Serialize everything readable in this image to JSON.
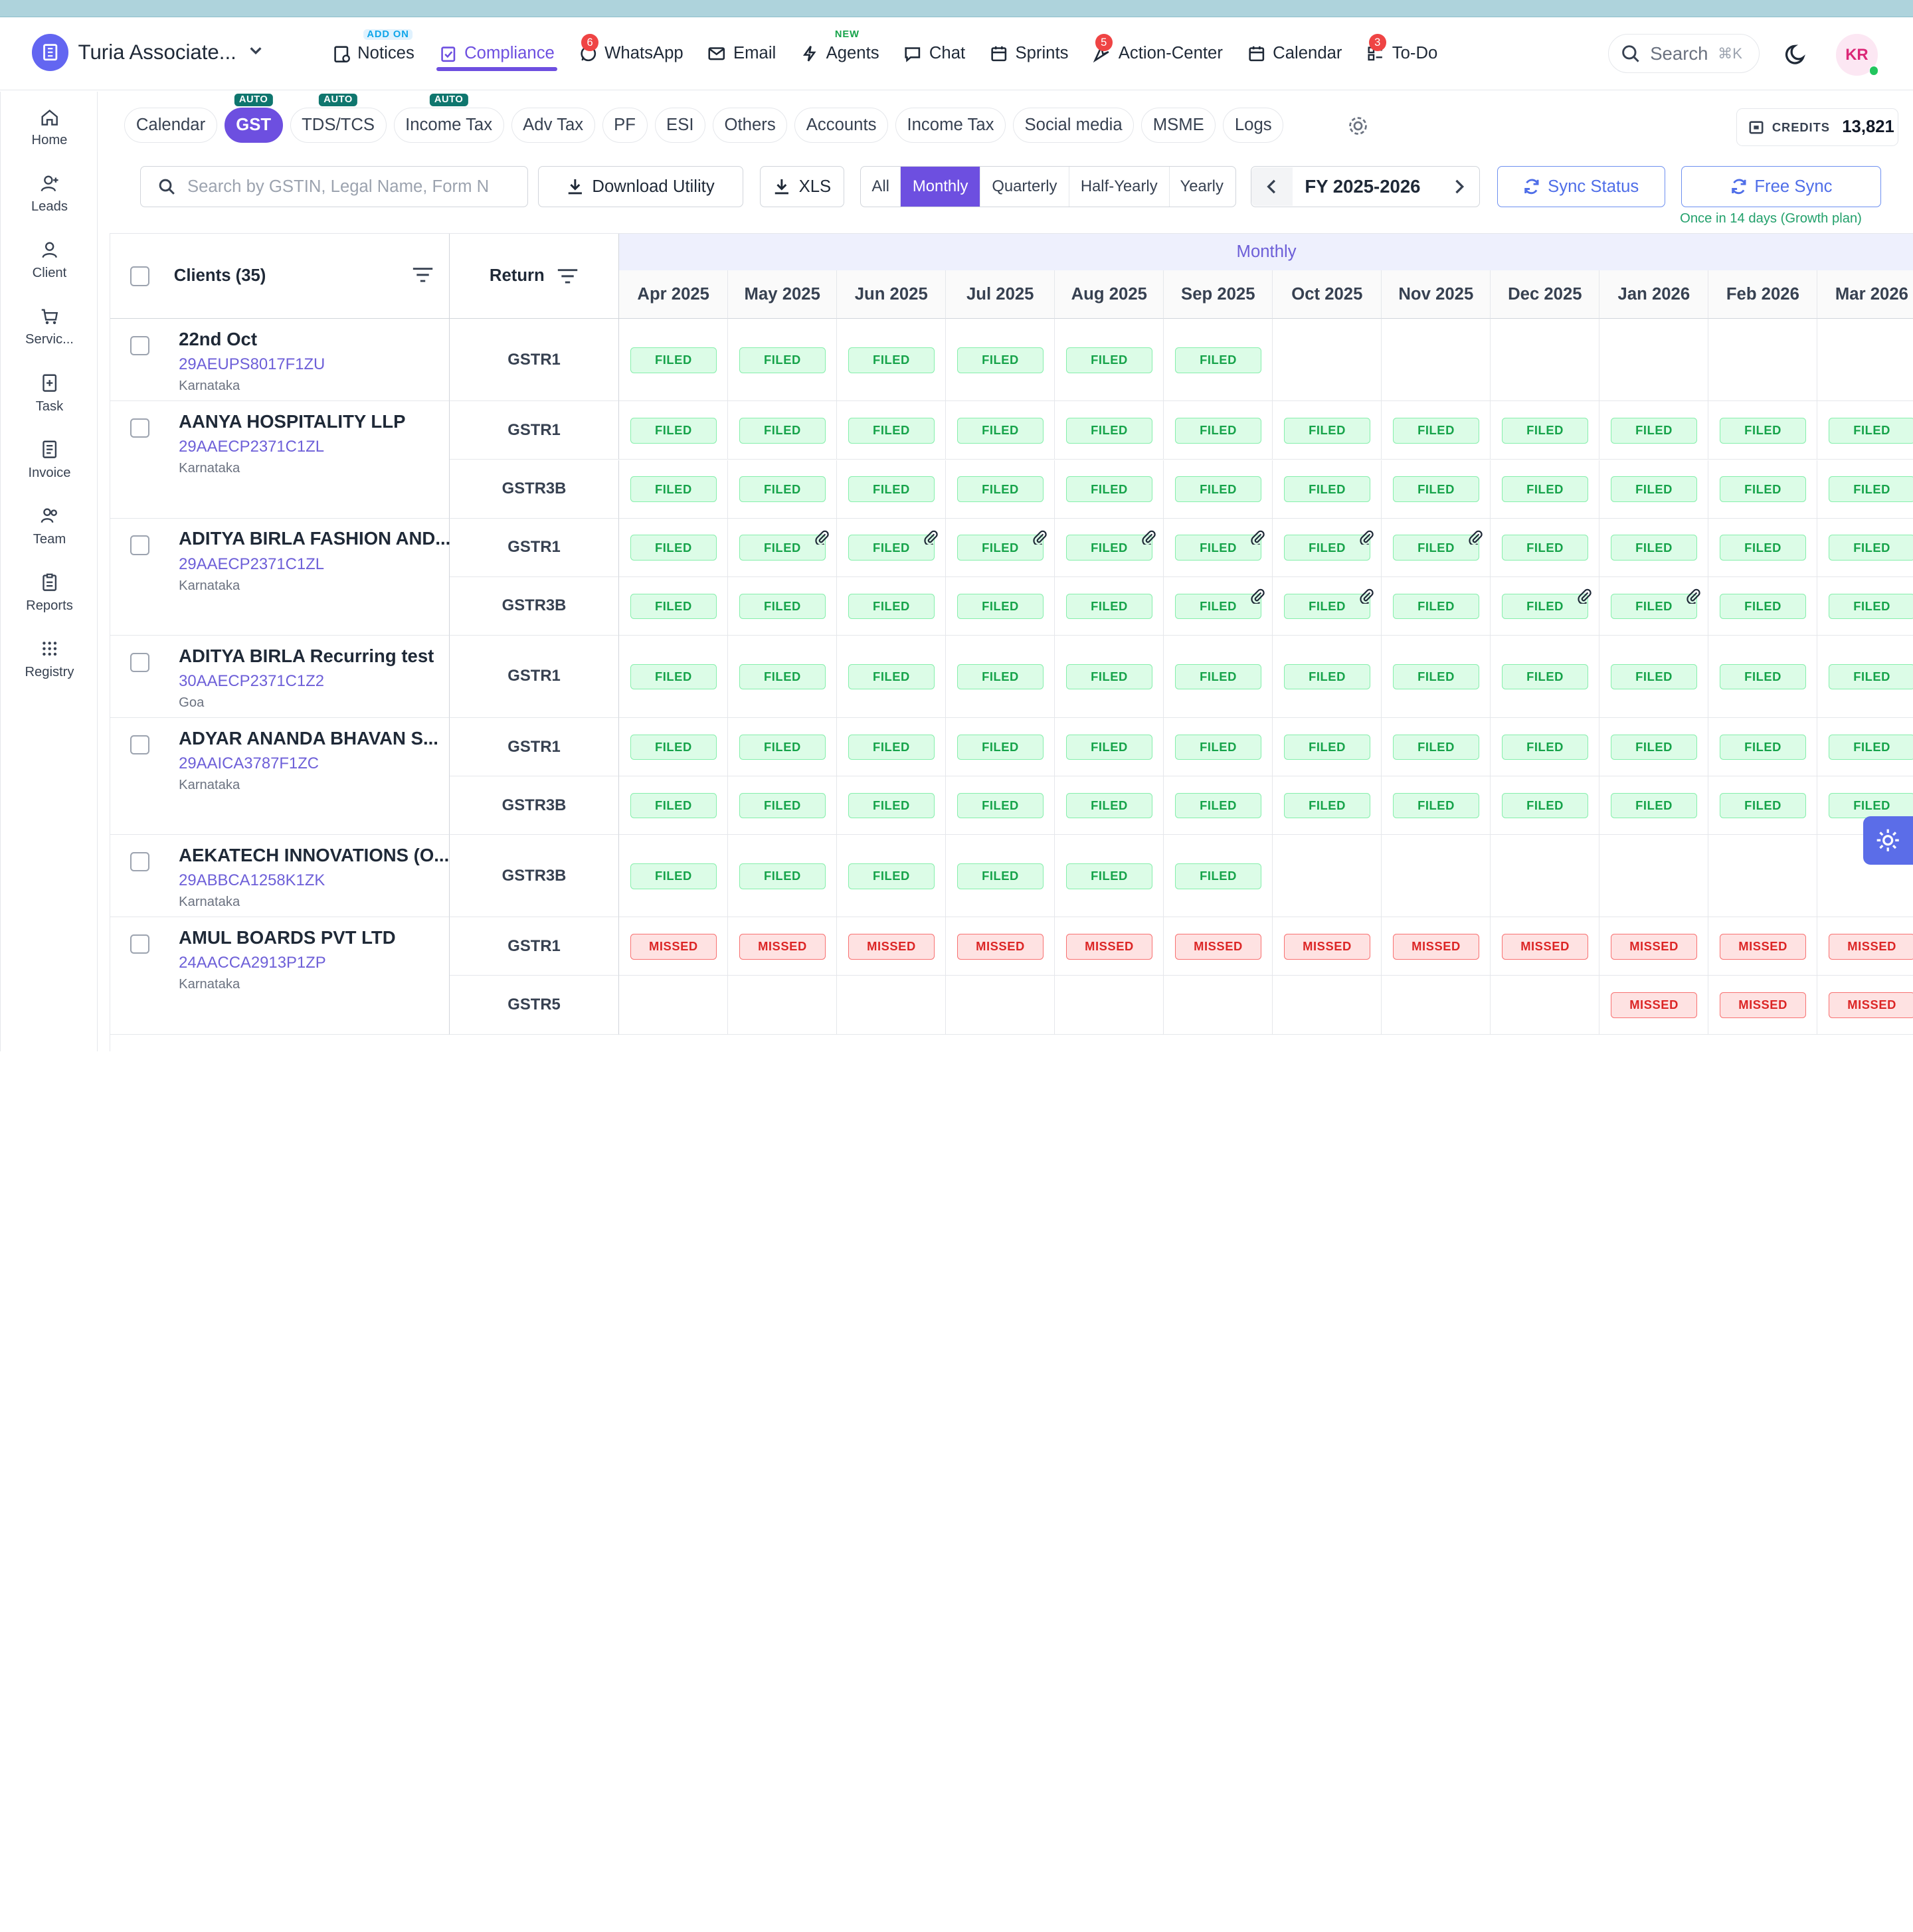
{
  "org": {
    "name": "Turia Associate..."
  },
  "nav": [
    {
      "label": "Notices",
      "icon": "notice-icon",
      "tag": "ADD ON"
    },
    {
      "label": "Compliance",
      "icon": "compliance-icon",
      "active": true
    },
    {
      "label": "WhatsApp",
      "icon": "whatsapp-icon",
      "badge": "6"
    },
    {
      "label": "Email",
      "icon": "email-icon"
    },
    {
      "label": "Agents",
      "icon": "bolt-icon",
      "tag": "NEW"
    },
    {
      "label": "Chat",
      "icon": "chat-icon"
    },
    {
      "label": "Sprints",
      "icon": "sprints-icon"
    },
    {
      "label": "Action-Center",
      "icon": "action-center-icon",
      "badge": "5"
    },
    {
      "label": "Calendar",
      "icon": "calendar-icon"
    },
    {
      "label": "To-Do",
      "icon": "todo-icon",
      "badge": "3"
    }
  ],
  "search": {
    "label": "Search",
    "shortcut": "⌘K"
  },
  "user": {
    "initials": "KR"
  },
  "sidebar": [
    {
      "label": "Home",
      "icon": "home-icon"
    },
    {
      "label": "Leads",
      "icon": "leads-icon"
    },
    {
      "label": "Client",
      "icon": "client-icon"
    },
    {
      "label": "Servic...",
      "icon": "services-icon"
    },
    {
      "label": "Task",
      "icon": "task-icon"
    },
    {
      "label": "Invoice",
      "icon": "invoice-icon"
    },
    {
      "label": "Team",
      "icon": "team-icon"
    },
    {
      "label": "Reports",
      "icon": "reports-icon"
    },
    {
      "label": "Registry",
      "icon": "registry-icon"
    }
  ],
  "tabs": [
    {
      "label": "Calendar"
    },
    {
      "label": "GST",
      "auto": "AUTO",
      "active": true
    },
    {
      "label": "TDS/TCS",
      "auto": "AUTO"
    },
    {
      "label": "Income Tax",
      "auto": "AUTO"
    },
    {
      "label": "Adv Tax"
    },
    {
      "label": "PF"
    },
    {
      "label": "ESI"
    },
    {
      "label": "Others"
    },
    {
      "label": "Accounts"
    },
    {
      "label": "Income Tax"
    },
    {
      "label": "Social media"
    },
    {
      "label": "MSME"
    },
    {
      "label": "Logs"
    }
  ],
  "credits": {
    "label": "CREDITS",
    "value": "13,821"
  },
  "toolbar": {
    "search_placeholder": "Search by GSTIN, Legal Name, Form N",
    "download_label": "Download Utility",
    "xls_label": "XLS",
    "periods": [
      "All",
      "Monthly",
      "Quarterly",
      "Half-Yearly",
      "Yearly"
    ],
    "active_period": "Monthly",
    "fy_label": "FY 2025-2026",
    "sync_status_label": "Sync Status",
    "free_sync_label": "Free Sync",
    "free_sync_note": "Once in 14 days (Growth plan)"
  },
  "table": {
    "clients_header": "Clients (35)",
    "return_header": "Return",
    "band_label": "Monthly",
    "months": [
      "Apr 2025",
      "May 2025",
      "Jun 2025",
      "Jul 2025",
      "Aug 2025",
      "Sep 2025",
      "Oct 2025",
      "Nov 2025",
      "Dec 2025",
      "Jan 2026",
      "Feb 2026",
      "Mar 2026"
    ],
    "clients": [
      {
        "name": "22nd Oct",
        "gstin": "29AEUPS8017F1ZU",
        "state": "Karnataka",
        "returns": [
          {
            "form": "GSTR1",
            "status": [
              "FILED",
              "FILED",
              "FILED",
              "FILED",
              "FILED",
              "FILED",
              "",
              "",
              "",
              "",
              "",
              ""
            ],
            "clips": []
          }
        ]
      },
      {
        "name": "AANYA HOSPITALITY LLP",
        "gstin": "29AAECP2371C1ZL",
        "state": "Karnataka",
        "returns": [
          {
            "form": "GSTR1",
            "status": [
              "FILED",
              "FILED",
              "FILED",
              "FILED",
              "FILED",
              "FILED",
              "FILED",
              "FILED",
              "FILED",
              "FILED",
              "FILED",
              "FILED"
            ],
            "clips": []
          },
          {
            "form": "GSTR3B",
            "status": [
              "FILED",
              "FILED",
              "FILED",
              "FILED",
              "FILED",
              "FILED",
              "FILED",
              "FILED",
              "FILED",
              "FILED",
              "FILED",
              "FILED"
            ],
            "clips": []
          }
        ]
      },
      {
        "name": "ADITYA BIRLA FASHION AND...",
        "gstin": "29AAECP2371C1ZL",
        "state": "Karnataka",
        "returns": [
          {
            "form": "GSTR1",
            "status": [
              "FILED",
              "FILED",
              "FILED",
              "FILED",
              "FILED",
              "FILED",
              "FILED",
              "FILED",
              "FILED",
              "FILED",
              "FILED",
              "FILED"
            ],
            "clips": [
              1,
              2,
              3,
              4,
              5,
              6,
              7
            ]
          },
          {
            "form": "GSTR3B",
            "status": [
              "FILED",
              "FILED",
              "FILED",
              "FILED",
              "FILED",
              "FILED",
              "FILED",
              "FILED",
              "FILED",
              "FILED",
              "FILED",
              "FILED"
            ],
            "clips": [
              5,
              6,
              8,
              9
            ]
          }
        ]
      },
      {
        "name": "ADITYA BIRLA Recurring test",
        "gstin": "30AAECP2371C1Z2",
        "state": "Goa",
        "returns": [
          {
            "form": "GSTR1",
            "status": [
              "FILED",
              "FILED",
              "FILED",
              "FILED",
              "FILED",
              "FILED",
              "FILED",
              "FILED",
              "FILED",
              "FILED",
              "FILED",
              "FILED"
            ],
            "clips": []
          }
        ]
      },
      {
        "name": "ADYAR ANANDA BHAVAN S...",
        "gstin": "29AAICA3787F1ZC",
        "state": "Karnataka",
        "returns": [
          {
            "form": "GSTR1",
            "status": [
              "FILED",
              "FILED",
              "FILED",
              "FILED",
              "FILED",
              "FILED",
              "FILED",
              "FILED",
              "FILED",
              "FILED",
              "FILED",
              "FILED"
            ],
            "clips": []
          },
          {
            "form": "GSTR3B",
            "status": [
              "FILED",
              "FILED",
              "FILED",
              "FILED",
              "FILED",
              "FILED",
              "FILED",
              "FILED",
              "FILED",
              "FILED",
              "FILED",
              "FILED"
            ],
            "clips": []
          }
        ]
      },
      {
        "name": "AEKATECH INNOVATIONS (O...",
        "gstin": "29ABBCA1258K1ZK",
        "state": "Karnataka",
        "returns": [
          {
            "form": "GSTR3B",
            "status": [
              "FILED",
              "FILED",
              "FILED",
              "FILED",
              "FILED",
              "FILED",
              "",
              "",
              "",
              "",
              "",
              ""
            ],
            "clips": []
          }
        ]
      },
      {
        "name": "AMUL BOARDS PVT LTD",
        "gstin": "24AACCA2913P1ZP",
        "state": "Karnataka",
        "returns": [
          {
            "form": "GSTR1",
            "status": [
              "MISSED",
              "MISSED",
              "MISSED",
              "MISSED",
              "MISSED",
              "MISSED",
              "MISSED",
              "MISSED",
              "MISSED",
              "MISSED",
              "MISSED",
              "MISSED"
            ],
            "clips": []
          },
          {
            "form": "GSTR5",
            "status": [
              "",
              "",
              "",
              "",
              "",
              "",
              "",
              "",
              "",
              "MISSED",
              "MISSED",
              "MISSED"
            ],
            "clips": []
          }
        ]
      }
    ]
  }
}
